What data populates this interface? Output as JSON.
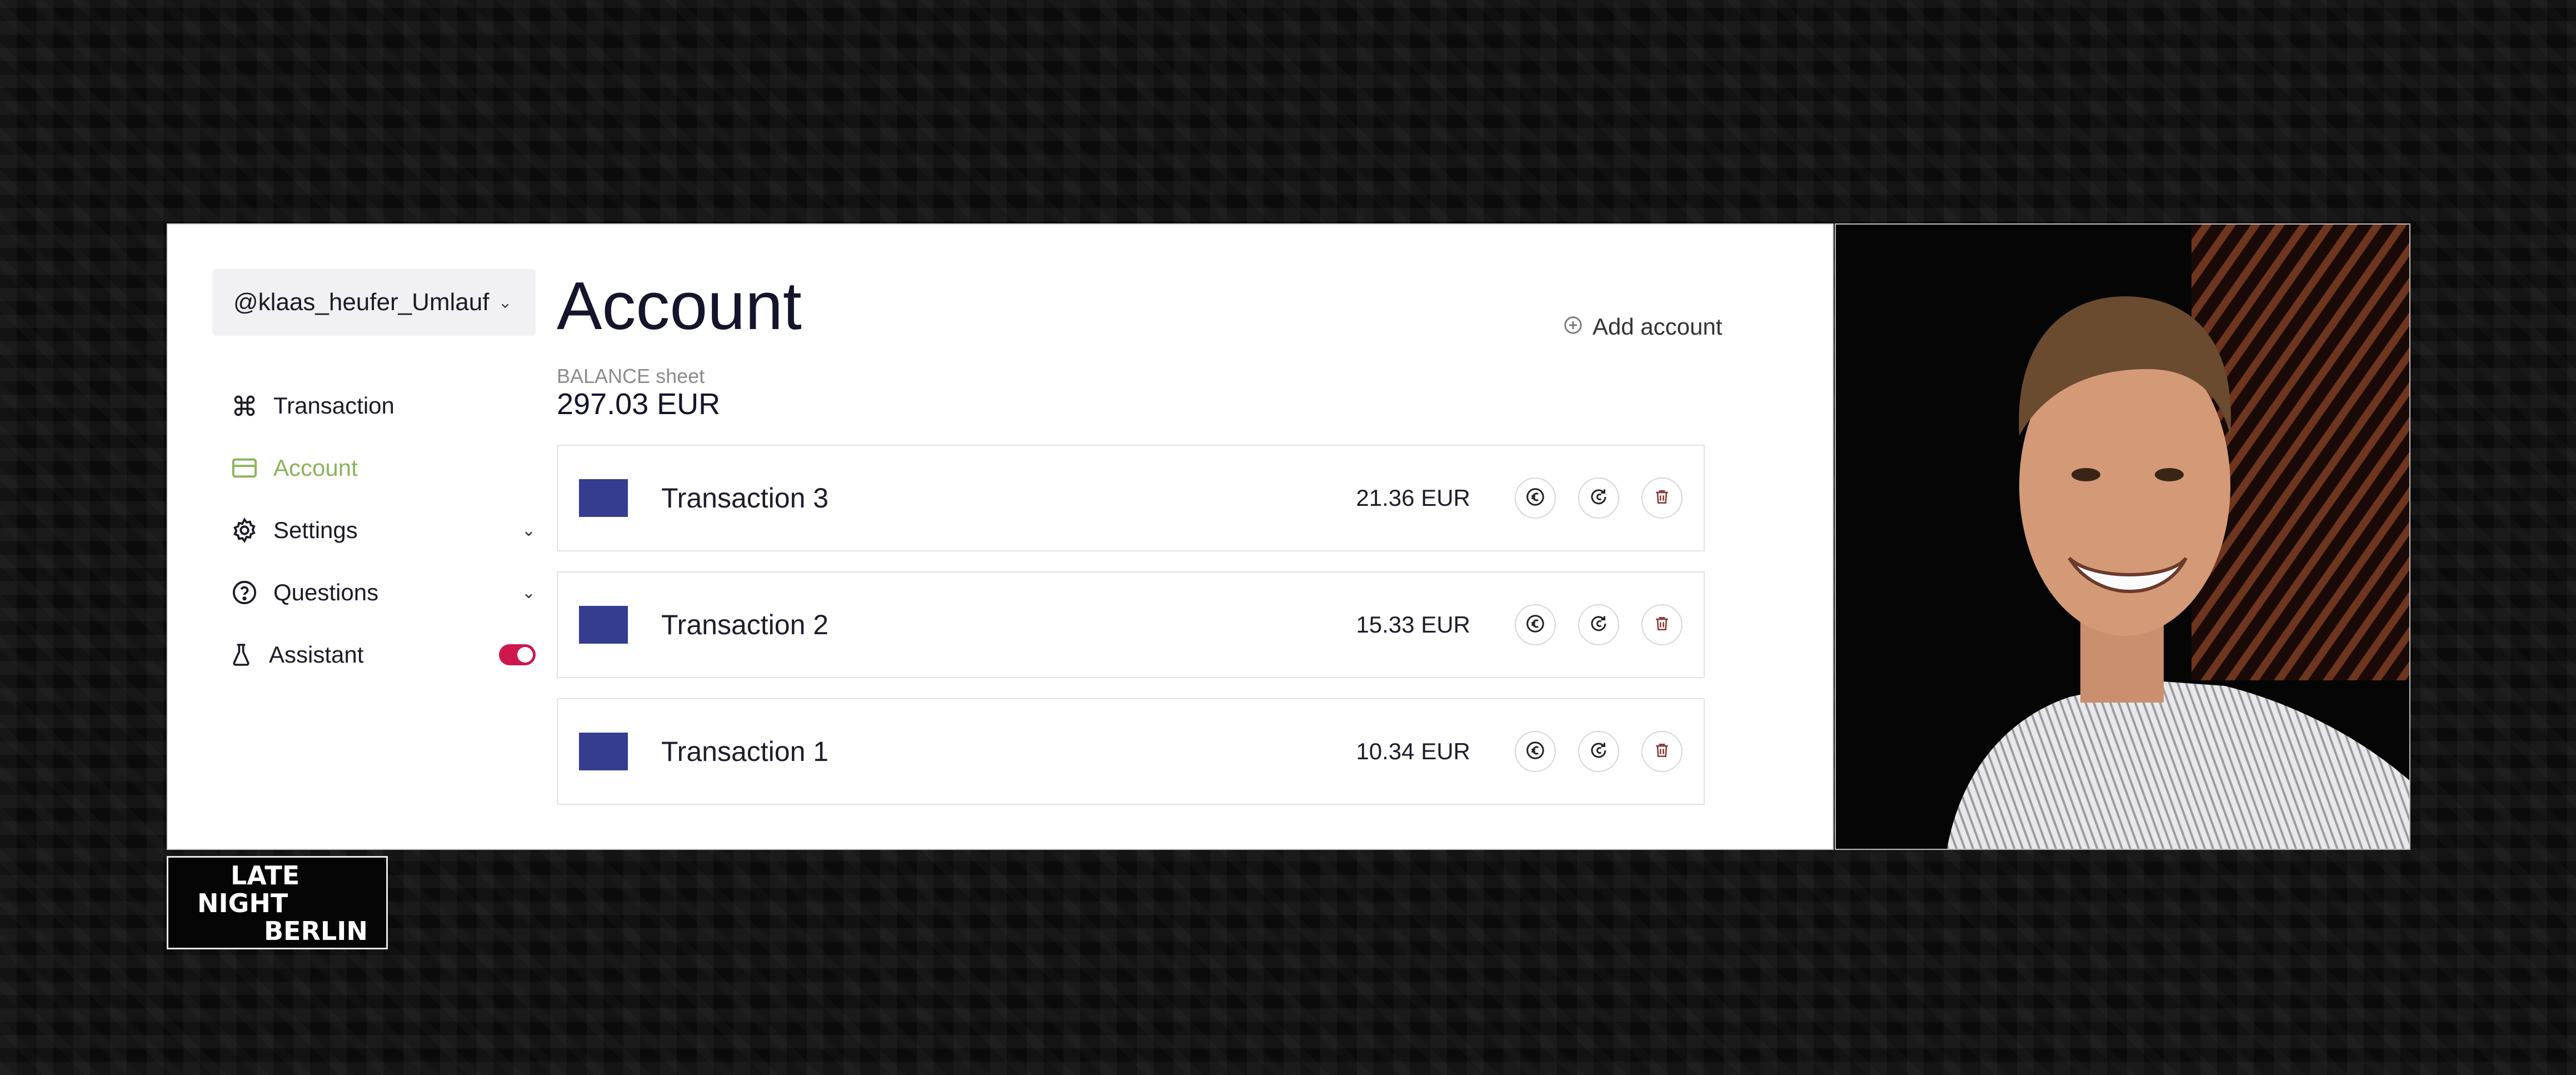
{
  "sidebar": {
    "user": "@klaas_heufer_Umlauf",
    "items": [
      {
        "label": "Transaction",
        "icon": "command-icon"
      },
      {
        "label": "Account",
        "icon": "card-icon",
        "active": true
      },
      {
        "label": "Settings",
        "icon": "gear-icon",
        "expandable": true
      },
      {
        "label": "Questions",
        "icon": "help-circle-icon",
        "expandable": true
      },
      {
        "label": "Assistant",
        "icon": "flask-icon",
        "toggle": true
      }
    ]
  },
  "main": {
    "title": "Account",
    "add_account": "Add account",
    "balance_label": "BALANCE sheet",
    "balance_value": "297.03 EUR",
    "transactions": [
      {
        "name": "Transaction 3",
        "amount": "21.36 EUR"
      },
      {
        "name": "Transaction 2",
        "amount": "15.33 EUR"
      },
      {
        "name": "Transaction 1",
        "amount": "10.34 EUR"
      }
    ]
  },
  "logo": {
    "lines": [
      "LATE",
      "NIGHT",
      "BERLIN"
    ]
  },
  "colors": {
    "accent_active": "#8bb35b",
    "toggle_on": "#cf174f",
    "swatch": "#343d8f"
  }
}
